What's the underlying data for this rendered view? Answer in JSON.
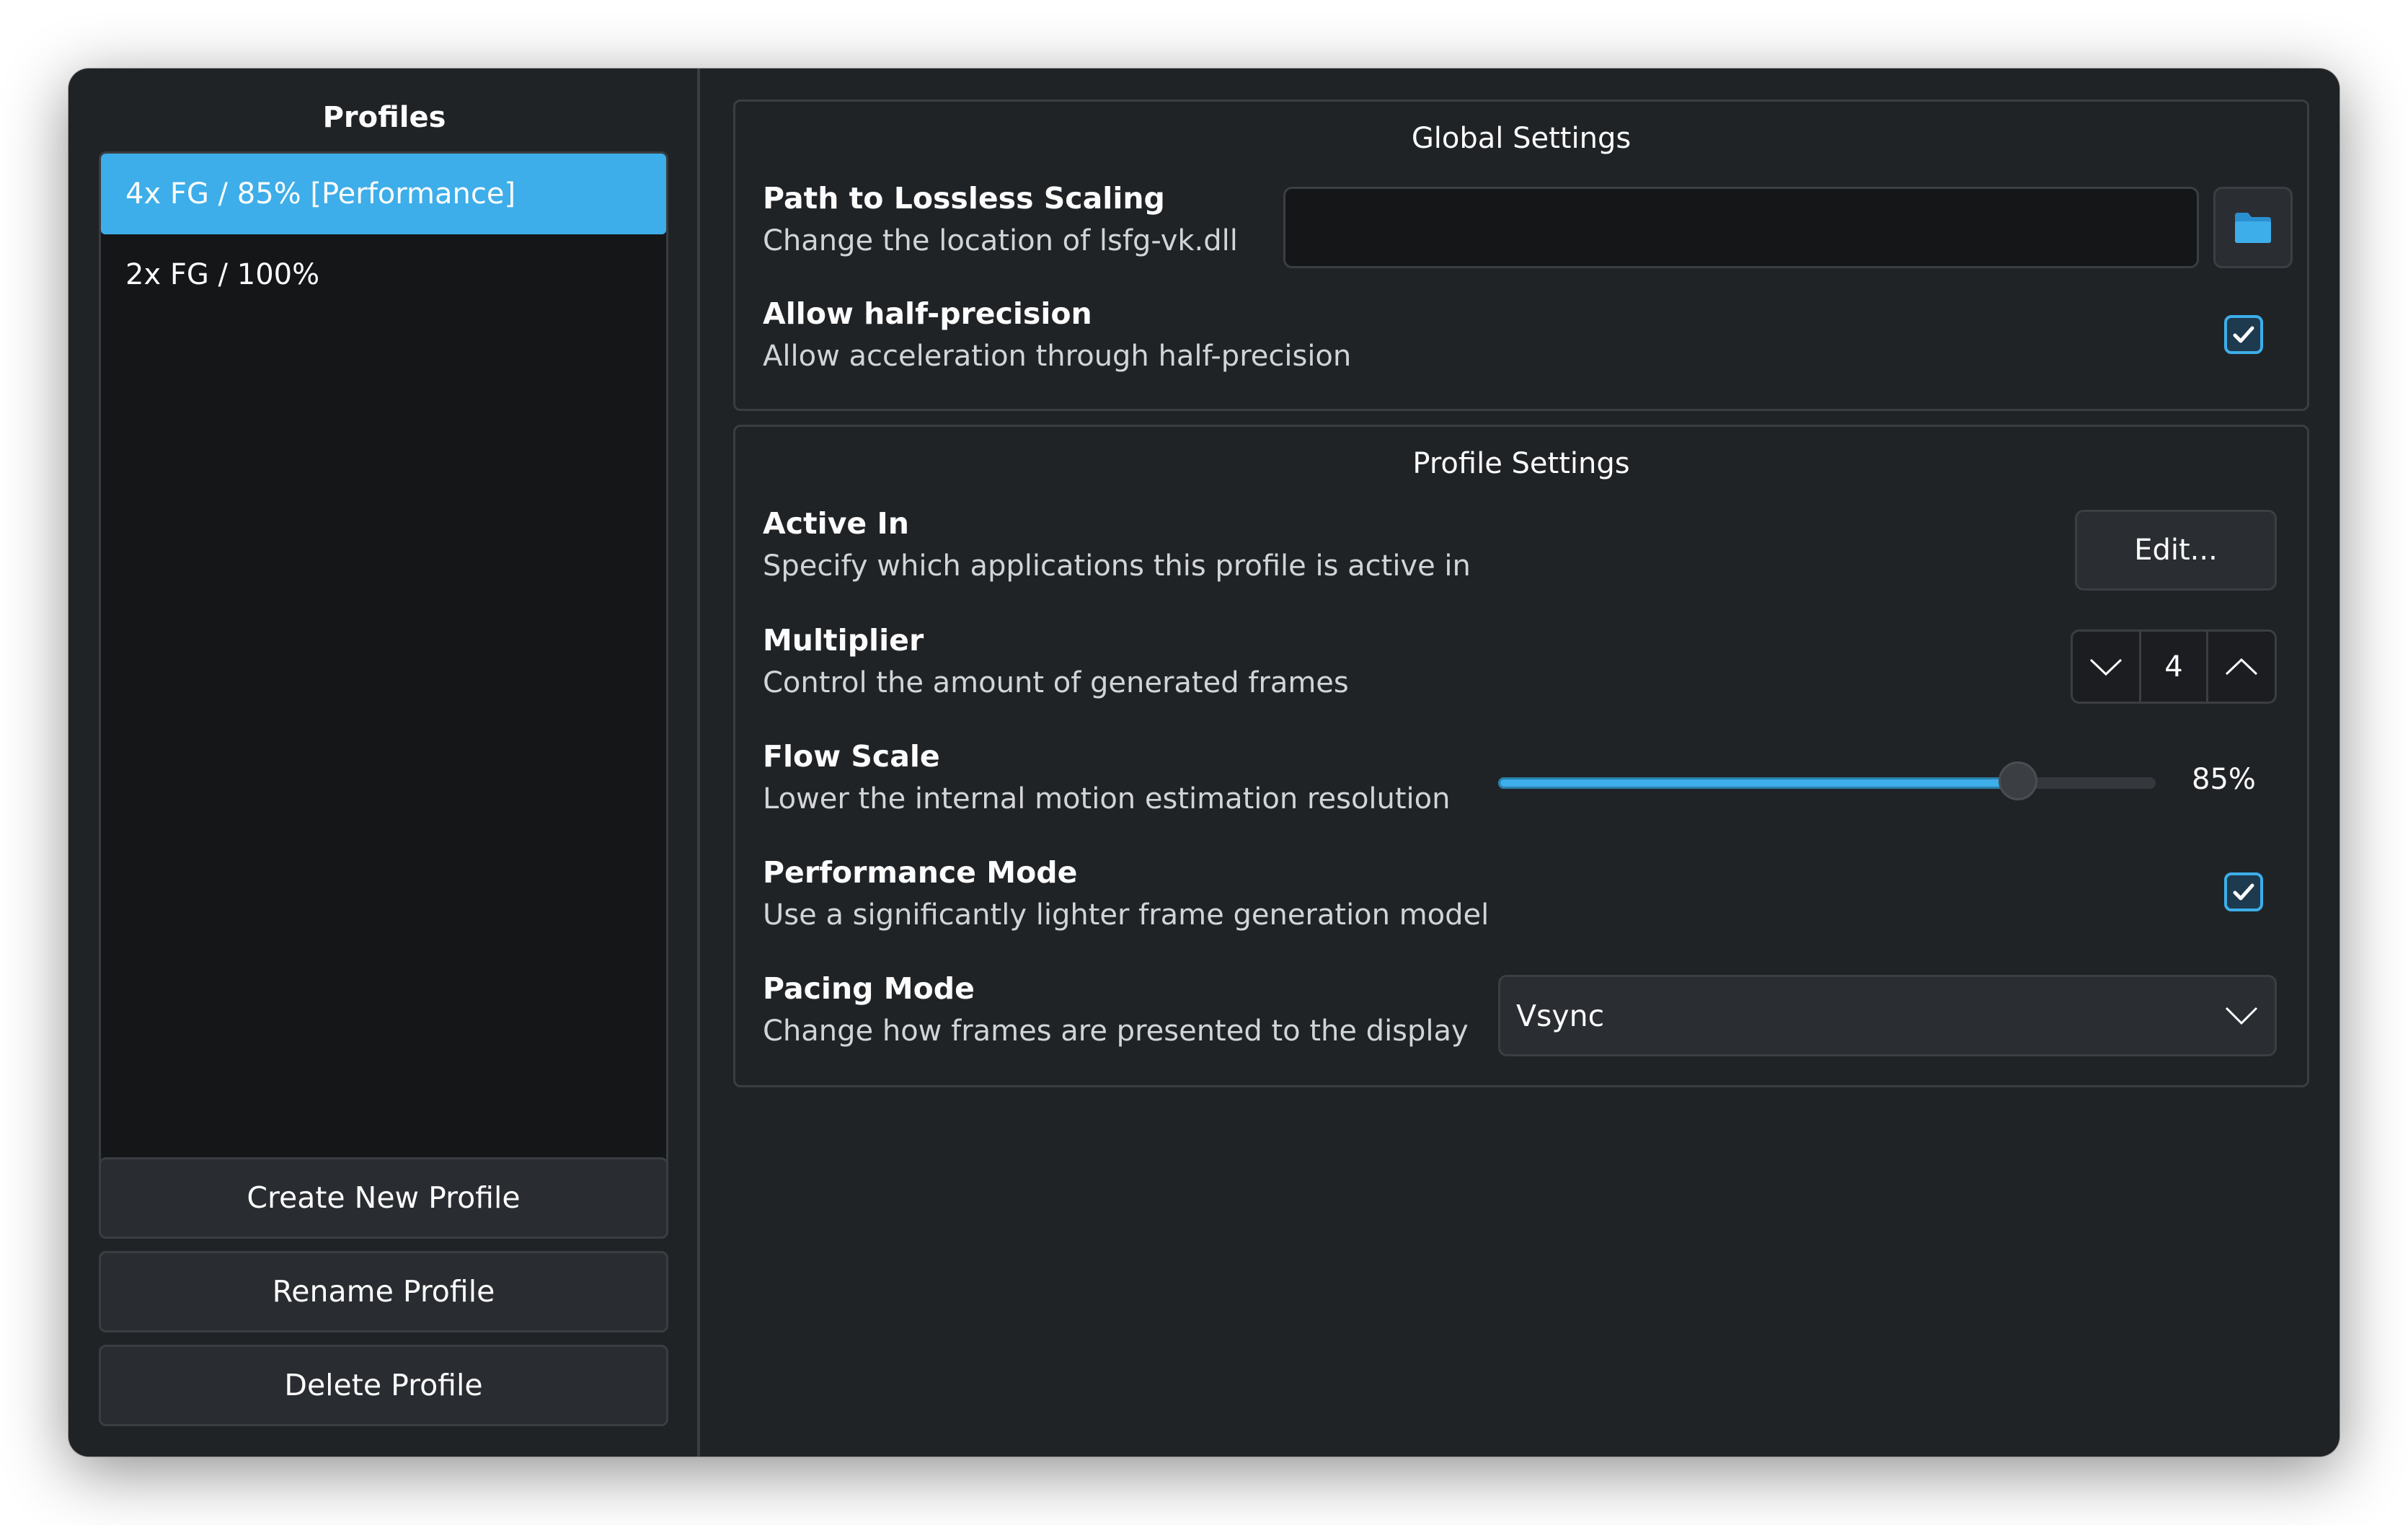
{
  "sidebar": {
    "title": "Profiles",
    "profiles": [
      {
        "label": "4x FG / 85% [Performance]",
        "selected": true
      },
      {
        "label": "2x FG / 100%",
        "selected": false
      }
    ],
    "buttons": {
      "create": "Create New Profile",
      "rename": "Rename Profile",
      "delete": "Delete Profile"
    }
  },
  "global_settings": {
    "title": "Global Settings",
    "path": {
      "title": "Path to Lossless Scaling",
      "description": "Change the location of lsfg-vk.dll",
      "value": "",
      "browse_icon": "folder-icon"
    },
    "half_precision": {
      "title": "Allow half-precision",
      "description": "Allow acceleration through half-precision",
      "checked": true
    }
  },
  "profile_settings": {
    "title": "Profile Settings",
    "active_in": {
      "title": "Active In",
      "description": "Specify which applications this profile is active in",
      "button_label": "Edit..."
    },
    "multiplier": {
      "title": "Multiplier",
      "description": "Control the amount of generated frames",
      "value": "4"
    },
    "flow_scale": {
      "title": "Flow Scale",
      "description": "Lower the internal motion estimation resolution",
      "percent": 85,
      "value_label": "85%"
    },
    "performance_mode": {
      "title": "Performance Mode",
      "description": "Use a significantly lighter frame generation model",
      "checked": true
    },
    "pacing_mode": {
      "title": "Pacing Mode",
      "description": "Change how frames are presented to the display",
      "selected": "Vsync"
    }
  },
  "colors": {
    "accent": "#3daee9",
    "window_bg": "#202326",
    "list_bg": "#141618",
    "text": "#fcfcfc"
  }
}
